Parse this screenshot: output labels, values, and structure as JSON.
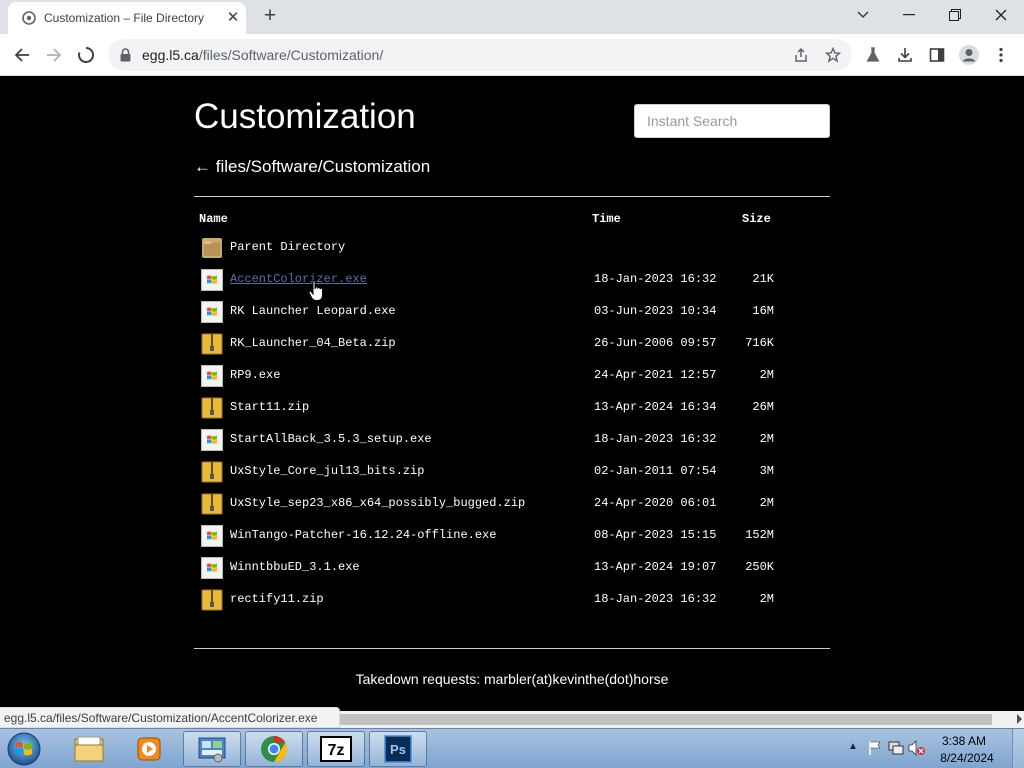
{
  "browser": {
    "tab_title": "Customization – File Directory",
    "url_host": "egg.l5.ca",
    "url_path": "/files/Software/Customization/",
    "status_url": "egg.l5.ca/files/Software/Customization/AccentColorizer.exe"
  },
  "page": {
    "title": "Customization",
    "search_placeholder": "Instant Search",
    "breadcrumb": "← files/Software/Customization",
    "columns": {
      "name": "Name",
      "time": "Time",
      "size": "Size"
    },
    "files": [
      {
        "name": "Parent Directory",
        "time": "",
        "size": "",
        "icon": "folder-icon"
      },
      {
        "name": "AccentColorizer.exe",
        "time": "18-Jan-2023 16:32",
        "size": "21K",
        "icon": "exe-icon",
        "hovered": true
      },
      {
        "name": "RK Launcher Leopard.exe",
        "time": "03-Jun-2023 10:34",
        "size": "16M",
        "icon": "exe-icon"
      },
      {
        "name": "RK_Launcher_04_Beta.zip",
        "time": "26-Jun-2006 09:57",
        "size": "716K",
        "icon": "zip-icon"
      },
      {
        "name": "RP9.exe",
        "time": "24-Apr-2021 12:57",
        "size": "2M",
        "icon": "exe-icon"
      },
      {
        "name": "Start11.zip",
        "time": "13-Apr-2024 16:34",
        "size": "26M",
        "icon": "zip-icon"
      },
      {
        "name": "StartAllBack_3.5.3_setup.exe",
        "time": "18-Jan-2023 16:32",
        "size": "2M",
        "icon": "exe-icon"
      },
      {
        "name": "UxStyle_Core_jul13_bits.zip",
        "time": "02-Jan-2011 07:54",
        "size": "3M",
        "icon": "zip-icon"
      },
      {
        "name": "UxStyle_sep23_x86_x64_possibly_bugged.zip",
        "time": "24-Apr-2020 06:01",
        "size": "2M",
        "icon": "zip-icon"
      },
      {
        "name": "WinTango-Patcher-16.12.24-offline.exe",
        "time": "08-Apr-2023 15:15",
        "size": "152M",
        "icon": "exe-icon"
      },
      {
        "name": "WinntbbuED_3.1.exe",
        "time": "13-Apr-2024 19:07",
        "size": "250K",
        "icon": "exe-icon"
      },
      {
        "name": "rectify11.zip",
        "time": "18-Jan-2023 16:32",
        "size": "2M",
        "icon": "zip-icon"
      }
    ],
    "footer": "Takedown requests: marbler(at)kevinthe(dot)horse"
  },
  "taskbar": {
    "apps": [
      {
        "name": "file-explorer",
        "icon": "folder-icon"
      },
      {
        "name": "media-player",
        "icon": "play-icon"
      },
      {
        "name": "control-panel",
        "icon": "control-panel-icon"
      },
      {
        "name": "chrome",
        "icon": "chrome-icon"
      },
      {
        "name": "7-zip",
        "icon": "7zip-icon",
        "label": "7z"
      },
      {
        "name": "photoshop",
        "icon": "photoshop-icon",
        "label": "Ps"
      }
    ],
    "clock_time": "3:38 AM",
    "clock_date": "8/24/2024"
  },
  "colors": {
    "page_bg": "#000000",
    "text": "#ffffff",
    "link_hover": "#5c6fa8",
    "taskbar": "#9ab8dc"
  }
}
